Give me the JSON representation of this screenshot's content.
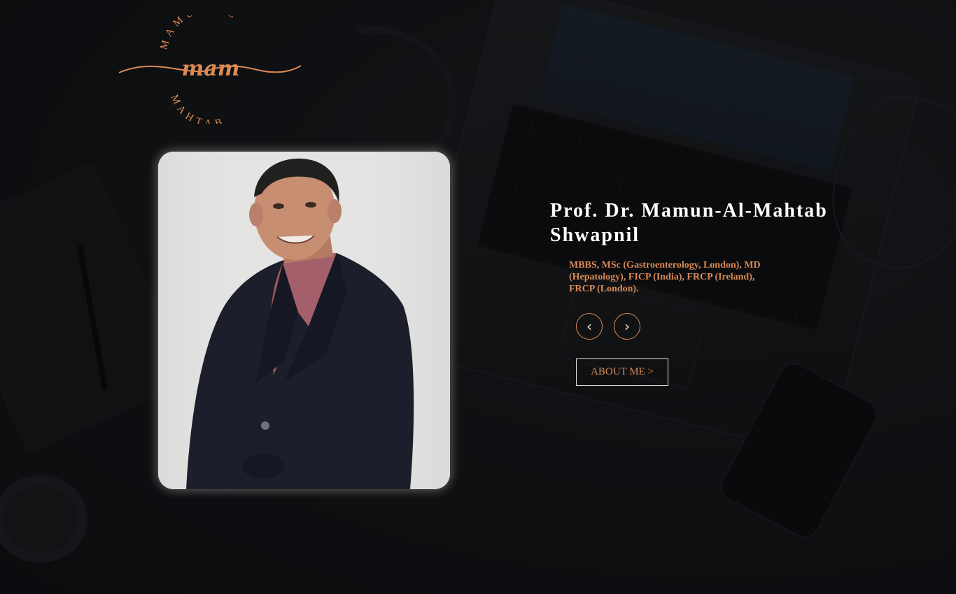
{
  "logo": {
    "top_arc_text": "MAMUN AL",
    "script_text": "mam",
    "bottom_arc_text": "MAHTAB",
    "color": "#d98a55"
  },
  "hero": {
    "name_line1": "Prof. Dr. Mamun-Al-Mahtab",
    "name_line2": "Shwapnil",
    "degrees": "MBBS, MSc (Gastroenterology, London), MD (Hepatology), FICP (India), FRCP (Ireland), FRCP (London).",
    "prev_icon": "‹",
    "next_icon": "›",
    "about_label": "ABOUT ME >"
  },
  "colors": {
    "accent": "#d98a55",
    "background": "#101214",
    "name_text": "#ffffff"
  },
  "icons": {
    "prev": "chevron-left-icon",
    "next": "chevron-right-icon"
  }
}
